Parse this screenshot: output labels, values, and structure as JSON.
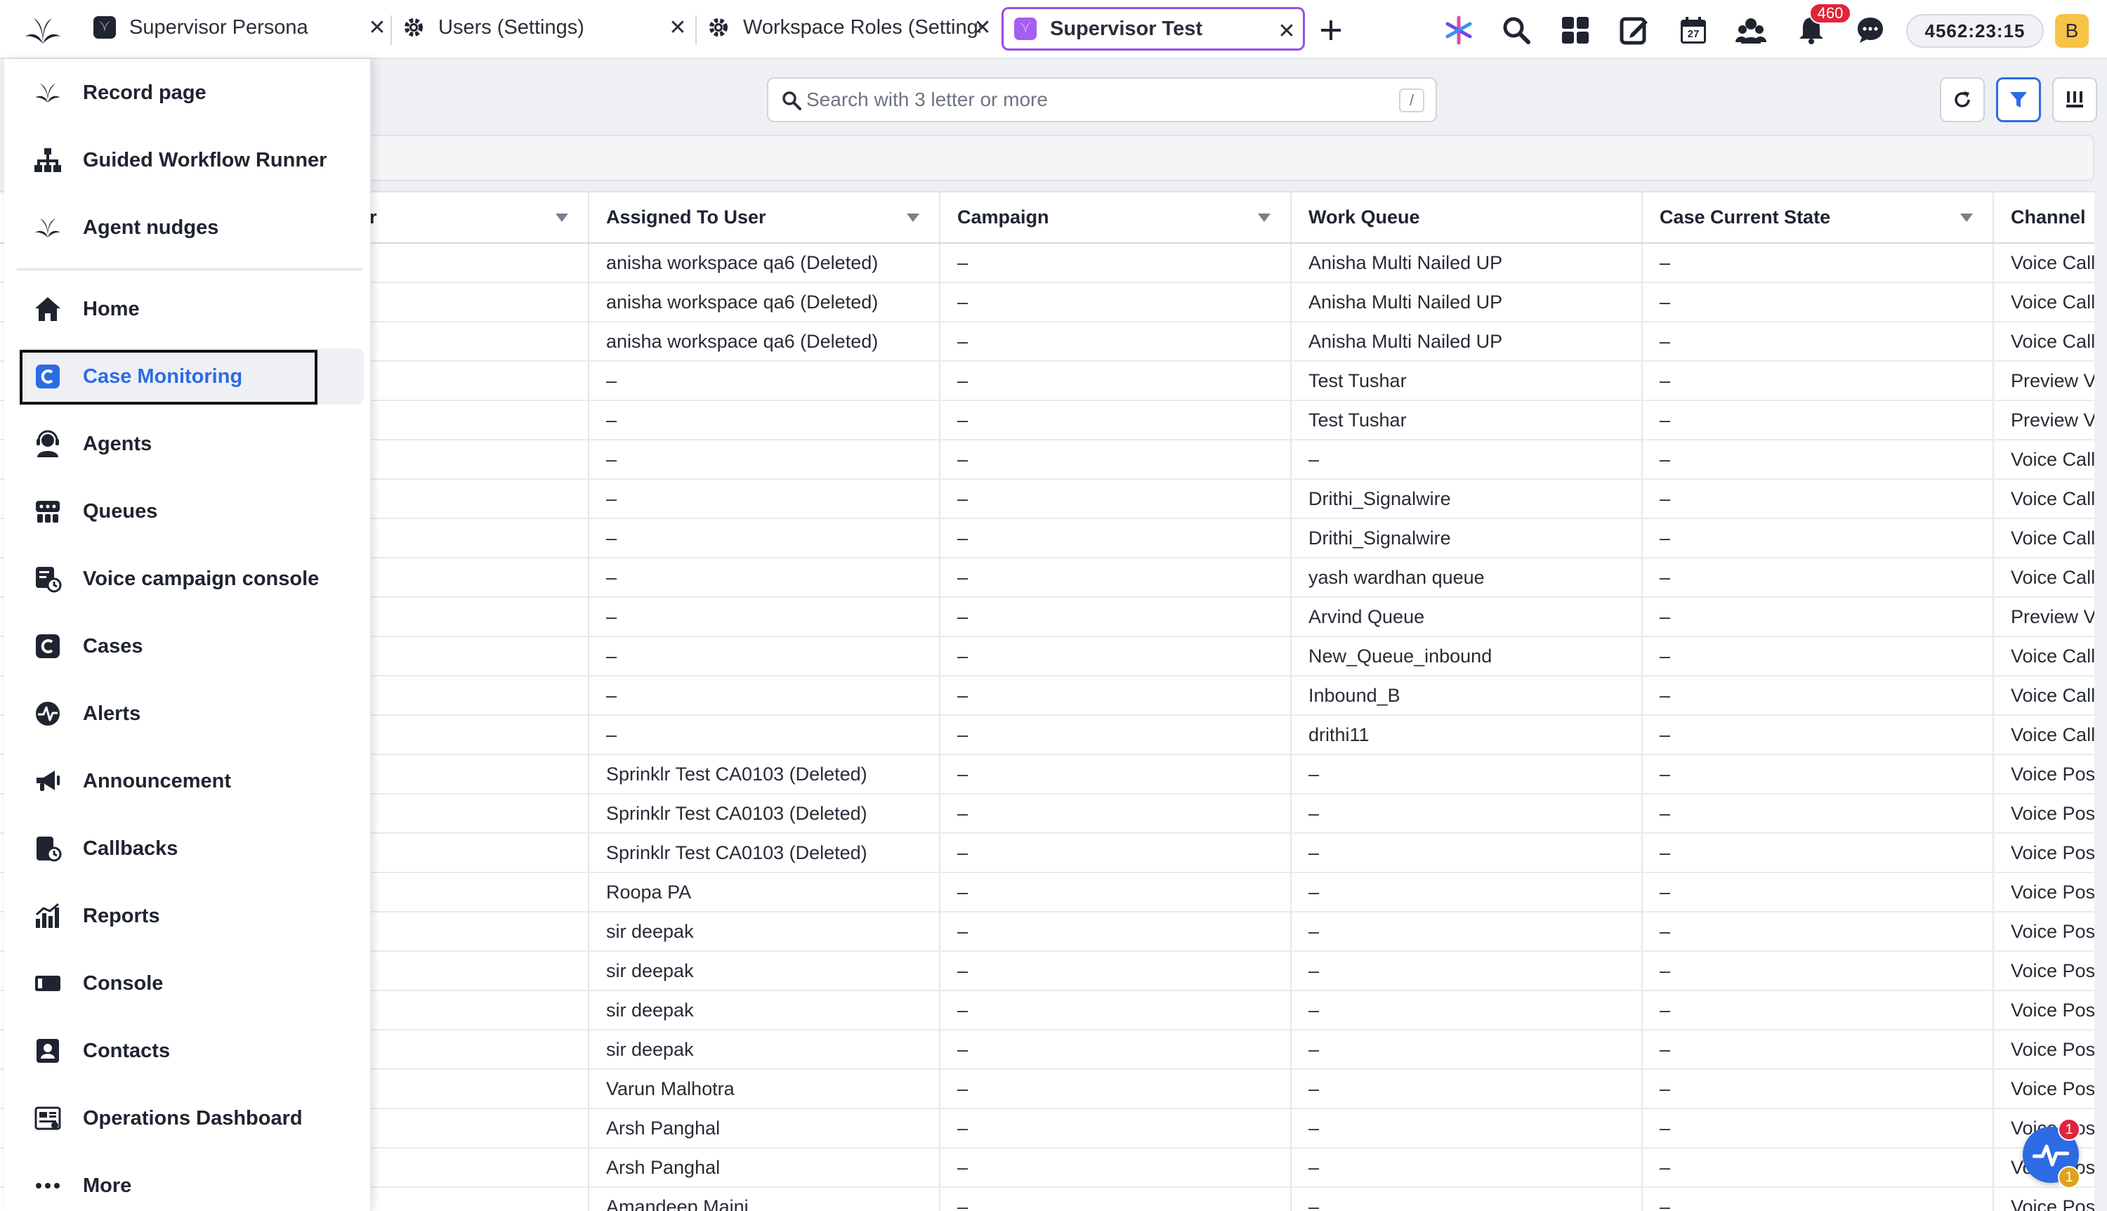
{
  "tabs": [
    {
      "title": "Supervisor Persona",
      "icon": "sprinklr-app-icon",
      "active": false
    },
    {
      "title": "Users (Settings)",
      "icon": "gear-icon",
      "active": false
    },
    {
      "title": "Workspace Roles (Settings)",
      "icon": "gear-icon",
      "active": false
    },
    {
      "title": "Supervisor Test",
      "icon": "sprinklr-app-icon",
      "active": true
    }
  ],
  "topbar": {
    "notification_count": "460",
    "timer": "4562:23:15",
    "avatar_initial": "B",
    "calendar_day": "27"
  },
  "toolbar": {
    "search_placeholder": "Search with 3 letter or more",
    "search_shortcut": "/"
  },
  "menu": {
    "items": [
      {
        "label": "Record page",
        "icon": "sprinklr-leaf-icon"
      },
      {
        "label": "Guided Workflow Runner",
        "icon": "workflow-tree-icon"
      },
      {
        "label": "Agent nudges",
        "icon": "sprinklr-leaf-icon"
      },
      {
        "label": "Home",
        "icon": "home-icon"
      },
      {
        "label": "Case Monitoring",
        "icon": "case-monitoring-icon",
        "active": true
      },
      {
        "label": "Agents",
        "icon": "agent-headset-icon"
      },
      {
        "label": "Queues",
        "icon": "queue-icon"
      },
      {
        "label": "Voice campaign console",
        "icon": "voice-campaign-icon"
      },
      {
        "label": "Cases",
        "icon": "case-icon"
      },
      {
        "label": "Alerts",
        "icon": "alert-pulse-icon"
      },
      {
        "label": "Announcement",
        "icon": "megaphone-icon"
      },
      {
        "label": "Callbacks",
        "icon": "callback-icon"
      },
      {
        "label": "Reports",
        "icon": "bar-chart-icon"
      },
      {
        "label": "Console",
        "icon": "console-icon"
      },
      {
        "label": "Contacts",
        "icon": "contact-card-icon"
      },
      {
        "label": "Operations Dashboard",
        "icon": "dashboard-icon"
      },
      {
        "label": "More",
        "icon": "more-dots-icon"
      }
    ]
  },
  "table": {
    "columns": [
      "r",
      "Assigned To User",
      "Campaign",
      "Work Queue",
      "Case Current State",
      "Channel"
    ],
    "rows": [
      [
        "",
        "anisha workspace qa6 (Deleted)",
        "–",
        "Anisha Multi Nailed UP",
        "–",
        "Voice Call"
      ],
      [
        "",
        "anisha workspace qa6 (Deleted)",
        "–",
        "Anisha Multi Nailed UP",
        "–",
        "Voice Call"
      ],
      [
        "",
        "anisha workspace qa6 (Deleted)",
        "–",
        "Anisha Multi Nailed UP",
        "–",
        "Voice Call"
      ],
      [
        "",
        "–",
        "–",
        "Test Tushar",
        "–",
        "Preview V"
      ],
      [
        "",
        "–",
        "–",
        "Test Tushar",
        "–",
        "Preview V"
      ],
      [
        "",
        "–",
        "–",
        "–",
        "–",
        "Voice Call"
      ],
      [
        "",
        "–",
        "–",
        "Drithi_Signalwire",
        "–",
        "Voice Call"
      ],
      [
        "",
        "–",
        "–",
        "Drithi_Signalwire",
        "–",
        "Voice Call"
      ],
      [
        "",
        "–",
        "–",
        "yash wardhan queue",
        "–",
        "Voice Call"
      ],
      [
        "",
        "–",
        "–",
        "Arvind Queue",
        "–",
        "Preview V"
      ],
      [
        "",
        "–",
        "–",
        "New_Queue_inbound",
        "–",
        "Voice Call"
      ],
      [
        "",
        "–",
        "–",
        "Inbound_B",
        "–",
        "Voice Call"
      ],
      [
        "",
        "–",
        "–",
        "drithi11",
        "–",
        "Voice Call"
      ],
      [
        "",
        "Sprinklr Test CA0103 (Deleted)",
        "–",
        "–",
        "–",
        "Voice Pos"
      ],
      [
        "",
        "Sprinklr Test CA0103 (Deleted)",
        "–",
        "–",
        "–",
        "Voice Pos"
      ],
      [
        "",
        "Sprinklr Test CA0103 (Deleted)",
        "–",
        "–",
        "–",
        "Voice Pos"
      ],
      [
        "",
        "Roopa PA",
        "–",
        "–",
        "–",
        "Voice Pos"
      ],
      [
        "",
        "sir deepak",
        "–",
        "–",
        "–",
        "Voice Pos"
      ],
      [
        "",
        "sir deepak",
        "–",
        "–",
        "–",
        "Voice Pos"
      ],
      [
        "",
        "sir deepak",
        "–",
        "–",
        "–",
        "Voice Pos"
      ],
      [
        "",
        "sir deepak",
        "–",
        "–",
        "–",
        "Voice Pos"
      ],
      [
        "",
        "Varun Malhotra",
        "–",
        "–",
        "–",
        "Voice Pos"
      ],
      [
        "",
        "Arsh Panghal",
        "–",
        "–",
        "–",
        "Voice Pos"
      ],
      [
        "",
        "Arsh Panghal",
        "–",
        "–",
        "–",
        "Voice Pos"
      ],
      [
        "",
        "Amandeep Maini",
        "–",
        "–",
        "–",
        "Voice Pos"
      ]
    ]
  },
  "widget": {
    "badge_top": "1",
    "badge_bottom": "1"
  },
  "colors": {
    "accent": "#2d6be4",
    "active_tab_border": "#9a4de6",
    "badge": "#e0243b",
    "avatar": "#f6c344"
  }
}
